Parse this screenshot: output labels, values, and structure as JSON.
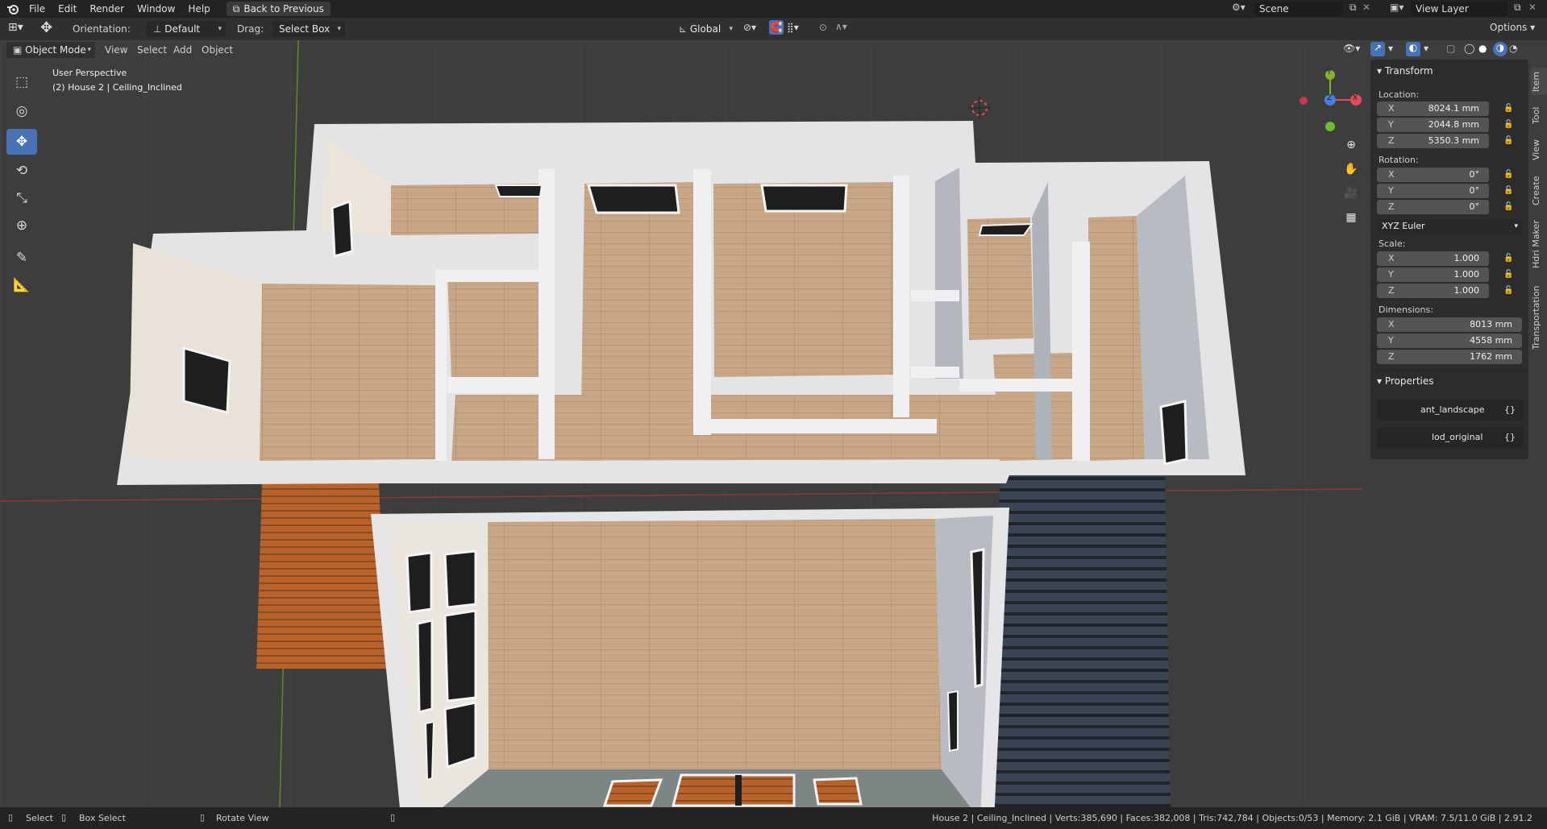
{
  "topbar": {
    "menus": [
      "File",
      "Edit",
      "Render",
      "Window",
      "Help"
    ],
    "back_button": "Back to Previous",
    "scene": "Scene",
    "view_layer": "View Layer"
  },
  "header": {
    "orientation_label": "Orientation:",
    "orientation_value": "Default",
    "drag_label": "Drag:",
    "drag_value": "Select Box",
    "transform_space": "Global",
    "options": "Options"
  },
  "viewport_header": {
    "mode": "Object Mode",
    "menus": [
      "View",
      "Select",
      "Add",
      "Object"
    ]
  },
  "viewport": {
    "perspective": "User Perspective",
    "object_path": "(2) House 2 | Ceiling_Inclined",
    "gizmo_axes": {
      "x": "X",
      "y": "Y",
      "z": "Z"
    }
  },
  "tools": [
    "select-box-tool",
    "cursor-tool",
    "move-tool",
    "rotate-tool",
    "scale-tool",
    "transform-tool",
    "annotate-tool",
    "measure-tool"
  ],
  "npanel": {
    "transform_title": "Transform",
    "location_label": "Location:",
    "location": [
      {
        "axis": "X",
        "value": "8024.1 mm"
      },
      {
        "axis": "Y",
        "value": "2044.8 mm"
      },
      {
        "axis": "Z",
        "value": "5350.3 mm"
      }
    ],
    "rotation_label": "Rotation:",
    "rotation": [
      {
        "axis": "X",
        "value": "0°"
      },
      {
        "axis": "Y",
        "value": "0°"
      },
      {
        "axis": "Z",
        "value": "0°"
      }
    ],
    "rotation_mode": "XYZ Euler",
    "scale_label": "Scale:",
    "scale": [
      {
        "axis": "X",
        "value": "1.000"
      },
      {
        "axis": "Y",
        "value": "1.000"
      },
      {
        "axis": "Z",
        "value": "1.000"
      }
    ],
    "dimensions_label": "Dimensions:",
    "dimensions": [
      {
        "axis": "X",
        "value": "8013 mm"
      },
      {
        "axis": "Y",
        "value": "4558 mm"
      },
      {
        "axis": "Z",
        "value": "1762 mm"
      }
    ],
    "properties_title": "Properties",
    "properties": [
      {
        "name": "ant_landscape",
        "icon": "{}"
      },
      {
        "name": "lod_original",
        "icon": "{}"
      }
    ]
  },
  "side_tabs": [
    "Item",
    "Tool",
    "View",
    "Create",
    "Hdri Maker",
    "Transportation"
  ],
  "statusbar": {
    "select": "Select",
    "box_select": "Box Select",
    "rotate_view": "Rotate View",
    "stats": "House 2 | Ceiling_Inclined | Verts:385,690 | Faces:382,008 | Tris:742,784 | Objects:0/53 | Memory: 2.1 GiB | VRAM: 7.5/11.0 GiB | 2.91.2"
  }
}
